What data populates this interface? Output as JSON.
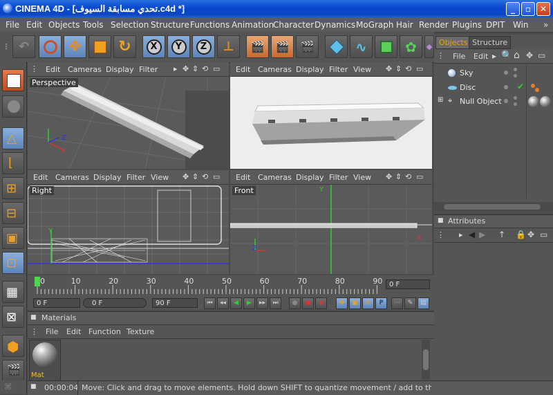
{
  "window": {
    "title": "CINEMA 4D - [تحدي مسابقة السيوف.c4d *]",
    "minimize": "_",
    "maximize": "▫",
    "close": "✕"
  },
  "menu": [
    "File",
    "Edit",
    "Objects",
    "Tools",
    "Selection",
    "Structure",
    "Functions",
    "Animation",
    "Character",
    "Dynamics",
    "MoGraph",
    "Hair",
    "Render",
    "Plugins",
    "DPIT",
    "Win"
  ],
  "toolbar": {
    "axis_x": "X",
    "axis_y": "Y",
    "axis_z": "Z"
  },
  "viewports": {
    "menu": [
      "Edit",
      "Cameras",
      "Display",
      "Filter",
      "View"
    ],
    "perspective": {
      "label": "Perspective"
    },
    "top_right": {
      "label": ""
    },
    "right": {
      "label": "Right"
    },
    "front": {
      "label": "Front"
    }
  },
  "axes": {
    "x": "X",
    "y": "Y",
    "z": "Z"
  },
  "objects_panel": {
    "tabs": [
      "Objects",
      "Structure"
    ],
    "menu": [
      "File",
      "Edit"
    ],
    "items": [
      {
        "name": "Sky"
      },
      {
        "name": "Disc"
      },
      {
        "name": "Null Object"
      }
    ]
  },
  "attributes_panel": {
    "title": "Attributes"
  },
  "timeline": {
    "ticks": [
      "0",
      "10",
      "20",
      "30",
      "40",
      "50",
      "60",
      "70",
      "80",
      "90"
    ],
    "current_frame_field": "0 F",
    "start_field": "0 F",
    "min_field": "0 F",
    "end_field": "90 F"
  },
  "materials": {
    "title": "Materials",
    "menu": [
      "File",
      "Edit",
      "Function",
      "Texture"
    ],
    "items": [
      {
        "name": "Mat"
      }
    ]
  },
  "status": {
    "time": "00:00:04",
    "message": "Move: Click and drag to move elements. Hold down SHIFT to quantize movement / add to the selection in p"
  },
  "colors": {
    "title_bar": "#0b45c4",
    "panel_bg": "#555555",
    "selected_tool": "#8ab0dc",
    "render_tool": "#c9682e",
    "active_tab": "#e8a400"
  }
}
